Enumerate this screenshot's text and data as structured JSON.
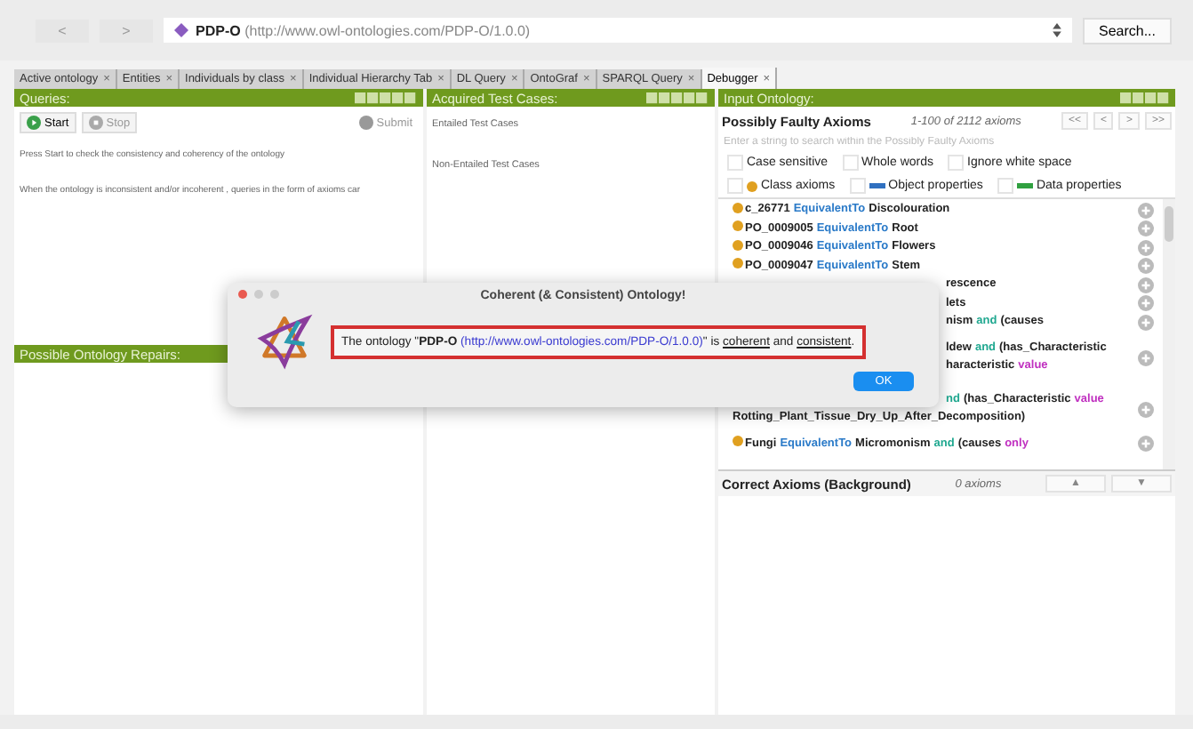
{
  "toolbar": {
    "back": "<",
    "forward": ">",
    "address": {
      "name": "PDP-O",
      "iri": "(http://www.owl-ontologies.com/PDP-O/1.0.0)"
    },
    "search": "Search..."
  },
  "tabs": [
    {
      "label": "Active ontology",
      "close": "×",
      "selected": false
    },
    {
      "label": "Entities",
      "close": "×",
      "selected": false
    },
    {
      "label": "Individuals by class",
      "close": "×",
      "selected": false
    },
    {
      "label": "Individual Hierarchy Tab",
      "close": "×",
      "selected": false
    },
    {
      "label": "DL Query",
      "close": "×",
      "selected": false
    },
    {
      "label": "OntoGraf",
      "close": "×",
      "selected": false
    },
    {
      "label": "SPARQL Query",
      "close": "×",
      "selected": false
    },
    {
      "label": "Debugger",
      "close": "×",
      "selected": true
    }
  ],
  "queries": {
    "title": "Queries:",
    "start": "Start",
    "stop": "Stop",
    "submit": "Submit",
    "lines": [
      "Press Start to check the consistency and coherency of the ontology",
      "When the ontology is inconsistent and/or incoherent , queries in the form of axioms car"
    ],
    "repairs_title": "Possible Ontology Repairs:"
  },
  "test_cases": {
    "title": "Acquired Test Cases:",
    "sections": [
      "Entailed Test Cases",
      "Non-Entailed Test Cases"
    ]
  },
  "input_ontology": {
    "title": "Input Ontology:",
    "faulty_title": "Possibly Faulty Axioms",
    "range": "1-100 of 2112 axioms",
    "pager": [
      "<<",
      "<",
      ">",
      ">>"
    ],
    "search_placeholder": "Enter a string to search within the Possibly Faulty Axioms",
    "options": [
      {
        "label": "Case sensitive",
        "checked": false
      },
      {
        "label": "Whole words",
        "checked": false
      },
      {
        "label": "Ignore white space",
        "checked": false
      }
    ],
    "types": [
      {
        "label": "Class axioms",
        "checked": false,
        "color": "#e0a020",
        "kind": "dot"
      },
      {
        "label": "Object properties",
        "checked": false,
        "color": "#3070c0",
        "kind": "bar"
      },
      {
        "label": "Data properties",
        "checked": false,
        "color": "#30a040",
        "kind": "bar"
      }
    ],
    "axioms": [
      {
        "lines": [
          {
            "partial": false,
            "segs": [
              {
                "kind": "entity",
                "text": "c_26771"
              },
              {
                "kind": "keyword",
                "text": "EquivalentTo"
              },
              {
                "kind": "entity",
                "text": "Discolouration"
              }
            ]
          }
        ]
      },
      {
        "lines": [
          {
            "partial": false,
            "segs": [
              {
                "kind": "entity",
                "text": "PO_0009005"
              },
              {
                "kind": "keyword",
                "text": "EquivalentTo"
              },
              {
                "kind": "entity",
                "text": "Root"
              }
            ]
          }
        ]
      },
      {
        "lines": [
          {
            "partial": false,
            "segs": [
              {
                "kind": "entity",
                "text": "PO_0009046"
              },
              {
                "kind": "keyword",
                "text": "EquivalentTo"
              },
              {
                "kind": "entity",
                "text": "Flowers"
              }
            ]
          }
        ]
      },
      {
        "lines": [
          {
            "partial": false,
            "segs": [
              {
                "kind": "entity",
                "text": "PO_0009047"
              },
              {
                "kind": "keyword",
                "text": "EquivalentTo"
              },
              {
                "kind": "entity",
                "text": "Stem"
              }
            ]
          }
        ]
      },
      {
        "lines": [
          {
            "partial": true,
            "segs": [
              {
                "kind": "entity",
                "text": "rescence"
              }
            ]
          }
        ]
      },
      {
        "lines": [
          {
            "partial": true,
            "segs": [
              {
                "kind": "entity",
                "text": "lets"
              }
            ]
          }
        ]
      },
      {
        "lines": [
          {
            "partial": true,
            "segs": [
              {
                "kind": "entity",
                "text": "nism"
              },
              {
                "kind": "connective",
                "text": "and"
              },
              {
                "kind": "entity",
                "text": "(causes"
              }
            ]
          }
        ]
      },
      {
        "lines": [
          {
            "partial": true,
            "segs": [
              {
                "kind": "entity",
                "text": "ldew"
              },
              {
                "kind": "connective",
                "text": "and"
              },
              {
                "kind": "entity",
                "text": "(has_Characteristic"
              }
            ]
          },
          {
            "partial": true,
            "segs": [
              {
                "kind": "entity",
                "text": "haracteristic"
              },
              {
                "kind": "restriction",
                "text": "value"
              }
            ]
          }
        ]
      },
      {
        "lines": [
          {
            "partial": true,
            "segs": [
              {
                "kind": "connective",
                "text": "nd"
              },
              {
                "kind": "entity",
                "text": "(has_Characteristic"
              },
              {
                "kind": "restriction",
                "text": "value"
              }
            ]
          },
          {
            "partial": false,
            "segs": [
              {
                "kind": "entity",
                "text": "Rotting_Plant_Tissue_Dry_Up_After_Decomposition)"
              }
            ]
          }
        ]
      },
      {
        "lines": [
          {
            "partial": false,
            "segs": [
              {
                "kind": "entity",
                "text": "Fungi"
              },
              {
                "kind": "keyword",
                "text": "EquivalentTo"
              },
              {
                "kind": "entity",
                "text": "Micromonism"
              },
              {
                "kind": "connective",
                "text": "and"
              },
              {
                "kind": "entity",
                "text": "(causes"
              },
              {
                "kind": "restriction",
                "text": "only"
              }
            ]
          }
        ]
      }
    ],
    "correct_title": "Correct Axioms (Background)",
    "correct_count": "0 axioms",
    "up": "▲",
    "down": "▼"
  },
  "dialog": {
    "title": "Coherent (& Consistent) Ontology!",
    "message": [
      {
        "kind": "plain",
        "text": "The ontology \""
      },
      {
        "kind": "bold",
        "text": "PDP-O"
      },
      {
        "kind": "link",
        "text": " (http://www.owl-ontologies.com/PDP-O/1.0.0)"
      },
      {
        "kind": "plain",
        "text": "\" is "
      },
      {
        "kind": "underline",
        "text": "coherent"
      },
      {
        "kind": "plain",
        "text": " and "
      },
      {
        "kind": "underline",
        "text": "consistent"
      },
      {
        "kind": "plain",
        "text": "."
      }
    ],
    "ok": "OK"
  }
}
